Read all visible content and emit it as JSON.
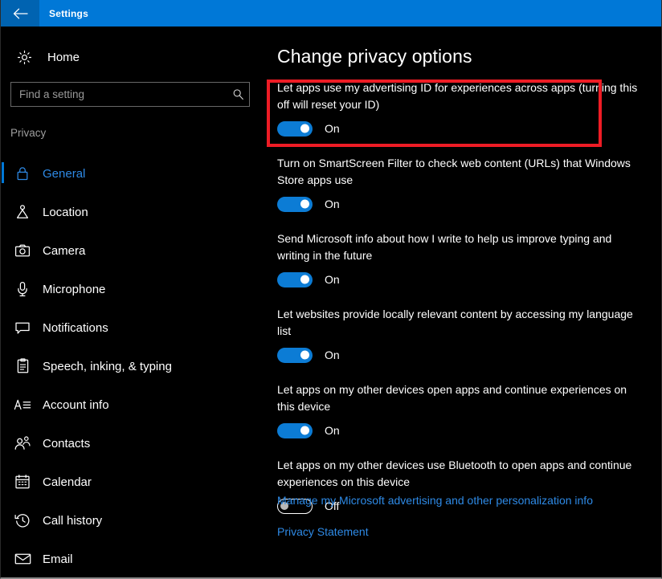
{
  "window": {
    "title": "Settings",
    "back_icon": "back-arrow-icon",
    "titlebar_color": "#0078d7",
    "back_button_color": "#0063b1"
  },
  "sidebar": {
    "home": {
      "label": "Home",
      "icon": "gear-icon"
    },
    "search": {
      "placeholder": "Find a setting",
      "value": "",
      "icon": "search-icon"
    },
    "group_label": "Privacy",
    "items": [
      {
        "label": "General",
        "icon": "lock-icon",
        "selected": true
      },
      {
        "label": "Location",
        "icon": "location-pin-icon",
        "selected": false
      },
      {
        "label": "Camera",
        "icon": "camera-icon",
        "selected": false
      },
      {
        "label": "Microphone",
        "icon": "microphone-icon",
        "selected": false
      },
      {
        "label": "Notifications",
        "icon": "notification-icon",
        "selected": false
      },
      {
        "label": "Speech, inking, & typing",
        "icon": "clipboard-icon",
        "selected": false
      },
      {
        "label": "Account info",
        "icon": "account-info-icon",
        "selected": false
      },
      {
        "label": "Contacts",
        "icon": "contacts-icon",
        "selected": false
      },
      {
        "label": "Calendar",
        "icon": "calendar-icon",
        "selected": false
      },
      {
        "label": "Call history",
        "icon": "call-history-icon",
        "selected": false
      },
      {
        "label": "Email",
        "icon": "email-icon",
        "selected": false
      }
    ]
  },
  "main": {
    "heading": "Change privacy options",
    "settings": [
      {
        "description": "Let apps use my advertising ID for experiences across apps (turning this off will reset your ID)",
        "state": "On",
        "on": true,
        "highlighted": true
      },
      {
        "description": "Turn on SmartScreen Filter to check web content (URLs) that Windows Store apps use",
        "state": "On",
        "on": true,
        "highlighted": false
      },
      {
        "description": "Send Microsoft info about how I write to help us improve typing and writing in the future",
        "state": "On",
        "on": true,
        "highlighted": false
      },
      {
        "description": "Let websites provide locally relevant content by accessing my language list",
        "state": "On",
        "on": true,
        "highlighted": false
      },
      {
        "description": "Let apps on my other devices open apps and continue experiences on this device",
        "state": "On",
        "on": true,
        "highlighted": false
      },
      {
        "description": "Let apps on my other devices use Bluetooth to open apps and continue experiences on this device",
        "state": "Off",
        "on": false,
        "highlighted": false
      }
    ],
    "links": [
      {
        "label": "Manage my Microsoft advertising and other personalization info"
      },
      {
        "label": "Privacy Statement"
      }
    ]
  },
  "colors": {
    "accent": "#0078d7",
    "link": "#2e8ae6",
    "toggle_on": "#0c7cd5",
    "highlight_box": "#ee1c25",
    "background": "#000000"
  }
}
